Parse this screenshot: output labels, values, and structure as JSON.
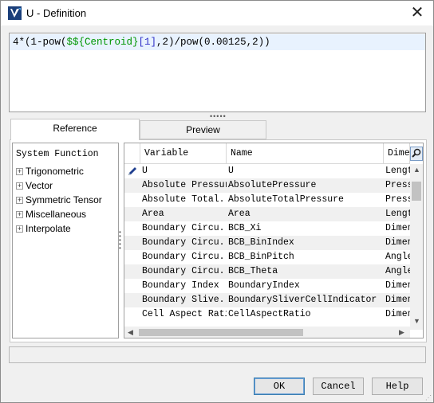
{
  "window": {
    "title": "U - Definition",
    "close_glyph": "✕"
  },
  "editor": {
    "expression_parts": [
      "4*(1-pow(",
      "$${Centroid}",
      "[1]",
      ",2)/pow(0.00125,2))"
    ]
  },
  "tabs": [
    {
      "label": "Reference",
      "selected": true
    },
    {
      "label": "Preview",
      "selected": false
    }
  ],
  "tree": {
    "header": "System Function",
    "items": [
      {
        "label": "Trigonometric"
      },
      {
        "label": "Vector"
      },
      {
        "label": "Symmetric Tensor"
      },
      {
        "label": "Miscellaneous"
      },
      {
        "label": "Interpolate"
      }
    ]
  },
  "table": {
    "columns": [
      "Variable",
      "Name",
      "Dimen"
    ],
    "rows": [
      {
        "variable": "U",
        "name": "U",
        "dimension": "Length",
        "editing": true
      },
      {
        "variable": "Absolute Pressure",
        "name": "AbsolutePressure",
        "dimension": "Pressu"
      },
      {
        "variable": "Absolute Total...",
        "name": "AbsoluteTotalPressure",
        "dimension": "Pressu"
      },
      {
        "variable": "Area",
        "name": "Area",
        "dimension": "Length"
      },
      {
        "variable": "Boundary Circu...",
        "name": "BCB_Xi",
        "dimension": "Dimens"
      },
      {
        "variable": "Boundary Circu...",
        "name": "BCB_BinIndex",
        "dimension": "Dimens"
      },
      {
        "variable": "Boundary Circu...",
        "name": "BCB_BinPitch",
        "dimension": "Angle"
      },
      {
        "variable": "Boundary Circu...",
        "name": "BCB_Theta",
        "dimension": "Angle"
      },
      {
        "variable": "Boundary Index",
        "name": "BoundaryIndex",
        "dimension": "Dimens"
      },
      {
        "variable": "Boundary Slive...",
        "name": "BoundarySliverCellIndicator",
        "dimension": "Dimens"
      },
      {
        "variable": "Cell Aspect Ratio",
        "name": "CellAspectRatio",
        "dimension": "Dimens"
      }
    ]
  },
  "status_text": "",
  "buttons": {
    "ok": "OK",
    "cancel": "Cancel",
    "help": "Help"
  },
  "colors": {
    "highlight_line": "#e8f2fe",
    "field_green": "#009600",
    "index_blue": "#3131c8"
  }
}
